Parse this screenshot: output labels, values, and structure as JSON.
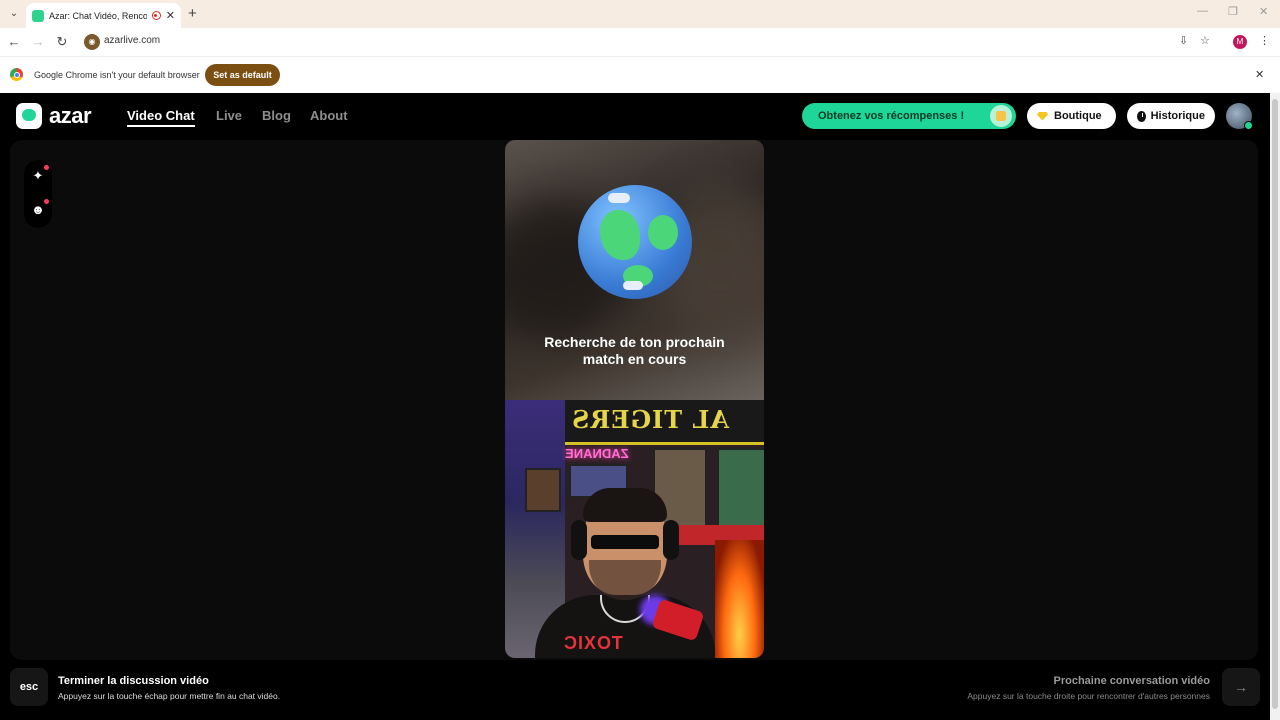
{
  "browser": {
    "tab_title": "Azar: Chat Vidéo, Rencontre",
    "url": "azarlive.com",
    "profile_initial": "M",
    "infobar": {
      "text": "Google Chrome isn't your default browser",
      "button": "Set as default"
    }
  },
  "header": {
    "logo_text": "azar",
    "nav": [
      {
        "label": "Video Chat",
        "active": true
      },
      {
        "label": "Live",
        "active": false
      },
      {
        "label": "Blog",
        "active": false
      },
      {
        "label": "About",
        "active": false
      }
    ],
    "rewards_label": "Obtenez vos récompenses !",
    "shop_label": "Boutique",
    "history_label": "Historique"
  },
  "match": {
    "status_line1": "Recherche de ton prochain",
    "status_line2": "match en cours",
    "banner_text": "AL TIGERS",
    "neon_text": "ZADNANE",
    "shirt_text": "TOXIC"
  },
  "footer": {
    "esc_key": "esc",
    "end_title": "Terminer la discussion vidéo",
    "end_sub": "Appuyez sur la touche échap pour mettre fin au chat vidéo.",
    "next_title": "Prochaine conversation vidéo",
    "next_sub": "Appuyez sur la touche droite pour rencontrer d'autres personnes",
    "next_key": "→"
  },
  "icons": {
    "tools": [
      "sparkle-effects-icon",
      "emoji-sticker-icon"
    ],
    "accent": "#1ed698",
    "notification_dot": "#ff3b5c"
  }
}
